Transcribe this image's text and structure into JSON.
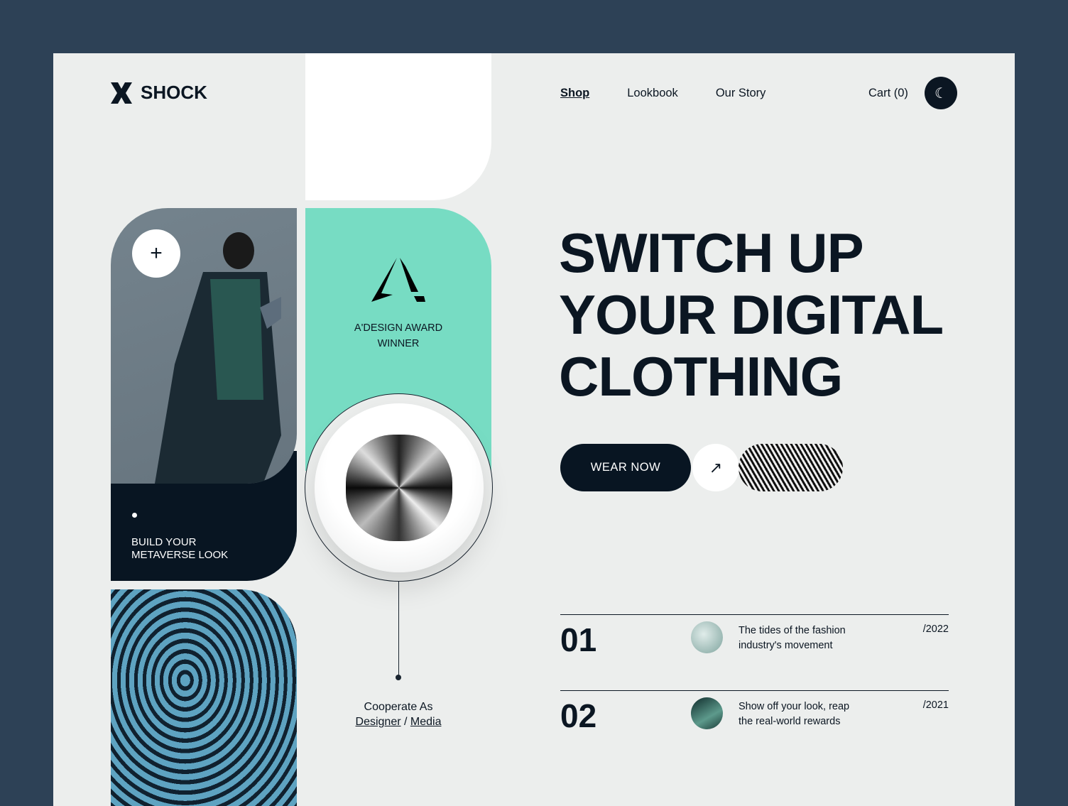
{
  "brand": {
    "name": "SHOCK"
  },
  "nav": {
    "items": [
      "Shop",
      "Lookbook",
      "Our Story"
    ],
    "active": "Shop",
    "cart": "Cart (0)",
    "theme_icon": "moon-icon"
  },
  "award": {
    "line1": "A'DESIGN AWARD",
    "line2": "WINNER"
  },
  "promo": {
    "line1": "BUILD YOUR",
    "line2": "METAVERSE LOOK"
  },
  "cooperate": {
    "label": "Cooperate As",
    "designer": "Designer",
    "sep": " / ",
    "media": "Media"
  },
  "hero": {
    "line1": "SWITCH UP",
    "line2": "YOUR DIGITAL",
    "line3": "CLOTHING",
    "cta": "WEAR NOW"
  },
  "rows": [
    {
      "num": "01",
      "line1": "The tides of the fashion",
      "line2": "industry's movement",
      "year": "/2022"
    },
    {
      "num": "02",
      "line1": "Show off your look, reap",
      "line2": "the real-world rewards",
      "year": "/2021"
    }
  ],
  "colors": {
    "background": "#2d4156",
    "page": "#eceeed",
    "teal": "#77dcc3",
    "dark": "#081522"
  }
}
